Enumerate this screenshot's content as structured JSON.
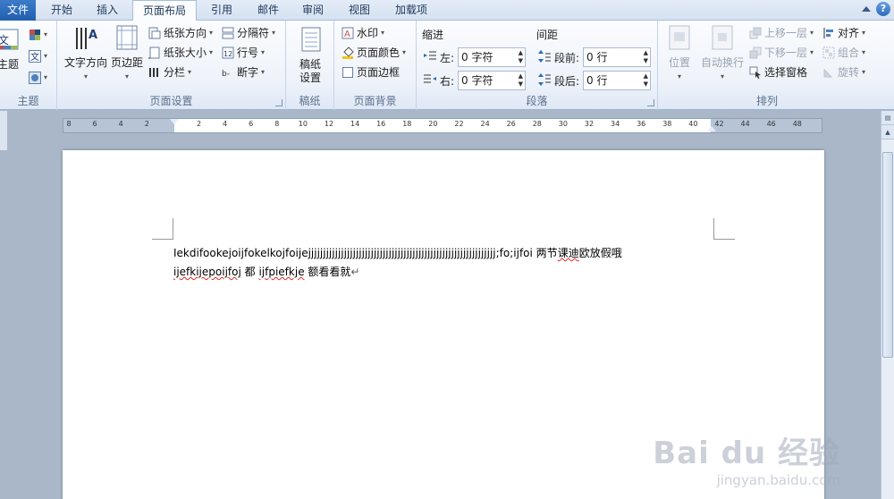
{
  "tabs": [
    {
      "label": "文件"
    },
    {
      "label": "开始"
    },
    {
      "label": "插入"
    },
    {
      "label": "页面布局"
    },
    {
      "label": "引用"
    },
    {
      "label": "邮件"
    },
    {
      "label": "审阅"
    },
    {
      "label": "视图"
    },
    {
      "label": "加载项"
    }
  ],
  "help_label": "?",
  "groups": {
    "theme": {
      "label": "主题",
      "theme_button": "主题"
    },
    "page_setup": {
      "label": "页面设置",
      "text_direction": "文字方向",
      "margins": "页边距",
      "orientation": "纸张方向",
      "size": "纸张大小",
      "columns": "分栏",
      "breaks": "分隔符",
      "line_numbers": "行号",
      "hyphenation": "断字"
    },
    "draft": {
      "label": "稿纸",
      "draft_setup_line1": "稿纸",
      "draft_setup_line2": "设置"
    },
    "background": {
      "label": "页面背景",
      "watermark": "水印",
      "page_color": "页面颜色",
      "page_border": "页面边框"
    },
    "paragraph": {
      "label": "段落",
      "indent_title": "缩进",
      "spacing_title": "间距",
      "left_label": "左:",
      "left_value": "0 字符",
      "right_label": "右:",
      "right_value": "0 字符",
      "before_label": "段前:",
      "before_value": "0 行",
      "after_label": "段后:",
      "after_value": "0 行"
    },
    "arrange": {
      "label": "排列",
      "position": "位置",
      "wrap_text": "自动换行",
      "bring_forward": "上移一层",
      "send_backward": "下移一层",
      "selection_pane": "选择窗格",
      "align": "对齐",
      "group": "组合",
      "rotate": "旋转"
    }
  },
  "ruler": {
    "labels": [
      "8",
      "6",
      "4",
      "2",
      "",
      "2",
      "4",
      "6",
      "8",
      "10",
      "12",
      "14",
      "16",
      "18",
      "20",
      "22",
      "24",
      "26",
      "28",
      "30",
      "32",
      "34",
      "36",
      "38",
      "40",
      "42",
      "44",
      "46",
      "48"
    ]
  },
  "document": {
    "line1_a": "Iekdifookejoijfokelkojfoijejjjjjjjjjjjjjjjjjjjjjjjjjjjjjjjjjjjjjjjjjjjjjjjjjjjjjjjjjjjjjjj;fo;ijfoi  两节",
    "line1_b": "课迪",
    "line1_c": "欧放假哦",
    "line2_a": "ijefkijepoijfoj",
    "line2_b": " 都 ",
    "line2_c": "ijfpiefkje",
    "line2_d": " 额看看就",
    "para_mark": "↵"
  },
  "watermark": {
    "logo": "Bai du 经验",
    "url": "jingyan.baidu.com"
  }
}
